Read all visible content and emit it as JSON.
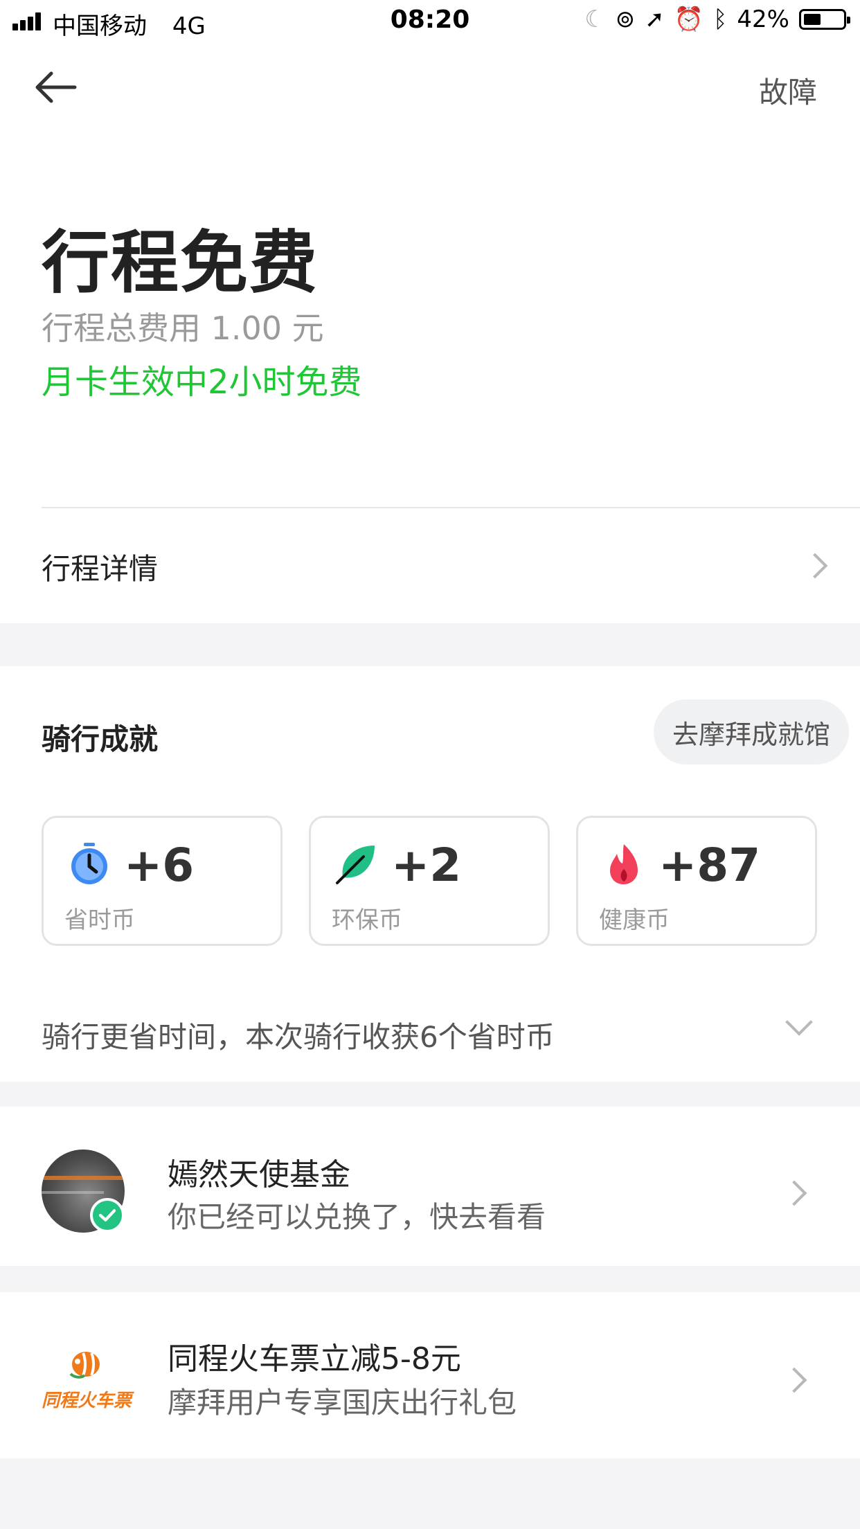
{
  "status_bar": {
    "carrier": "中国移动",
    "network": "4G",
    "time": "08:20",
    "battery": "42%"
  },
  "nav": {
    "back_icon": "back-arrow-icon",
    "fault_label": "故障"
  },
  "trip": {
    "headline": "行程免费",
    "total_fee": "行程总费用 1.00 元",
    "monthly_card_note": "月卡生效中2小时免费",
    "details_label": "行程详情"
  },
  "achievements": {
    "title": "骑行成就",
    "hall_button": "去摩拜成就馆",
    "coins": [
      {
        "value": "+6",
        "label": "省时币",
        "icon": "stopwatch-icon",
        "color": "#3d8bf2"
      },
      {
        "value": "+2",
        "label": "环保币",
        "icon": "leaf-icon",
        "color": "#1fbf86"
      },
      {
        "value": "+87",
        "label": "健康币",
        "icon": "flame-icon",
        "color": "#f2405a"
      }
    ],
    "summary": "骑行更省时间，本次骑行收获6个省时币"
  },
  "promos": [
    {
      "title": "嫣然天使基金",
      "subtitle": "你已经可以兑换了，快去看看",
      "icon": "charity-avatar"
    },
    {
      "title": "同程火车票立减5-8元",
      "subtitle": "摩拜用户专享国庆出行礼包",
      "icon": "tongcheng-logo",
      "logo_text": "同程火车票"
    }
  ],
  "colors": {
    "accent_green": "#21c637",
    "band_gray": "#f4f4f6"
  }
}
